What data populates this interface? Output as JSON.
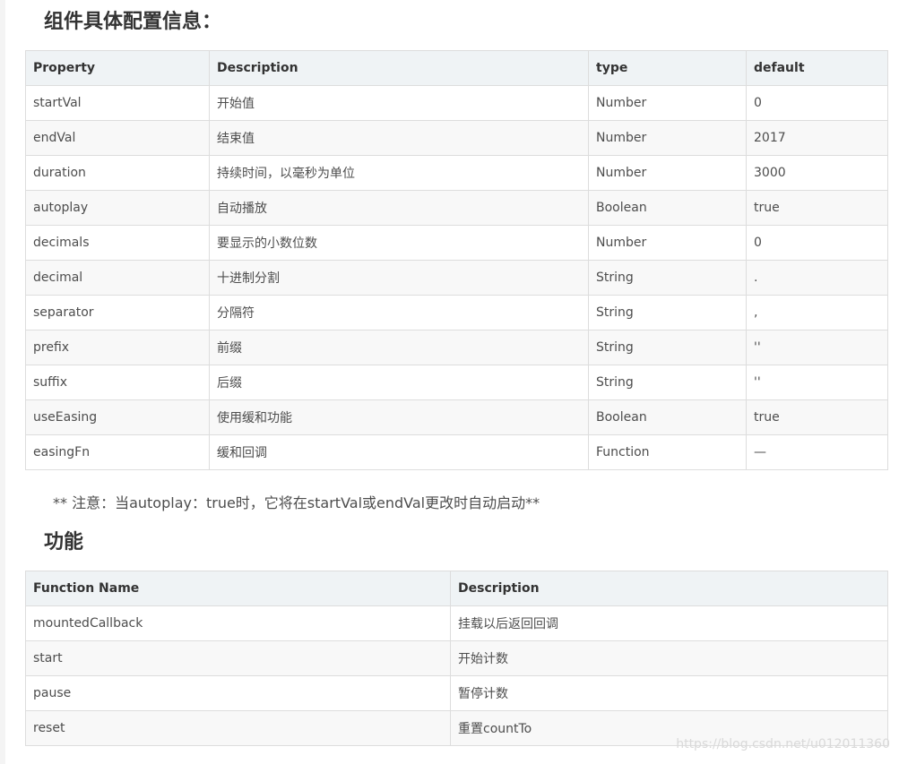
{
  "config_section": {
    "title": "组件具体配置信息：",
    "headers": [
      "Property",
      "Description",
      "type",
      "default"
    ],
    "rows": [
      [
        "startVal",
        "开始值",
        "Number",
        "0"
      ],
      [
        "endVal",
        "结束值",
        "Number",
        "2017"
      ],
      [
        "duration",
        "持续时间，以毫秒为单位",
        "Number",
        "3000"
      ],
      [
        "autoplay",
        "自动播放",
        "Boolean",
        "true"
      ],
      [
        "decimals",
        "要显示的小数位数",
        "Number",
        "0"
      ],
      [
        "decimal",
        "十进制分割",
        "String",
        "."
      ],
      [
        "separator",
        "分隔符",
        "String",
        ","
      ],
      [
        "prefix",
        "前缀",
        "String",
        "''"
      ],
      [
        "suffix",
        "后缀",
        "String",
        "''"
      ],
      [
        "useEasing",
        "使用缓和功能",
        "Boolean",
        "true"
      ],
      [
        "easingFn",
        "缓和回调",
        "Function",
        "—"
      ]
    ]
  },
  "note": "** 注意：当autoplay：true时，它将在startVal或endVal更改时自动启动**",
  "functions_section": {
    "title": "功能",
    "headers": [
      "Function Name",
      "Description"
    ],
    "rows": [
      [
        "mountedCallback",
        "挂载以后返回回调"
      ],
      [
        "start",
        "开始计数"
      ],
      [
        "pause",
        "暂停计数"
      ],
      [
        "reset",
        "重置countTo"
      ]
    ]
  },
  "watermark": "https://blog.csdn.net/u012011360"
}
